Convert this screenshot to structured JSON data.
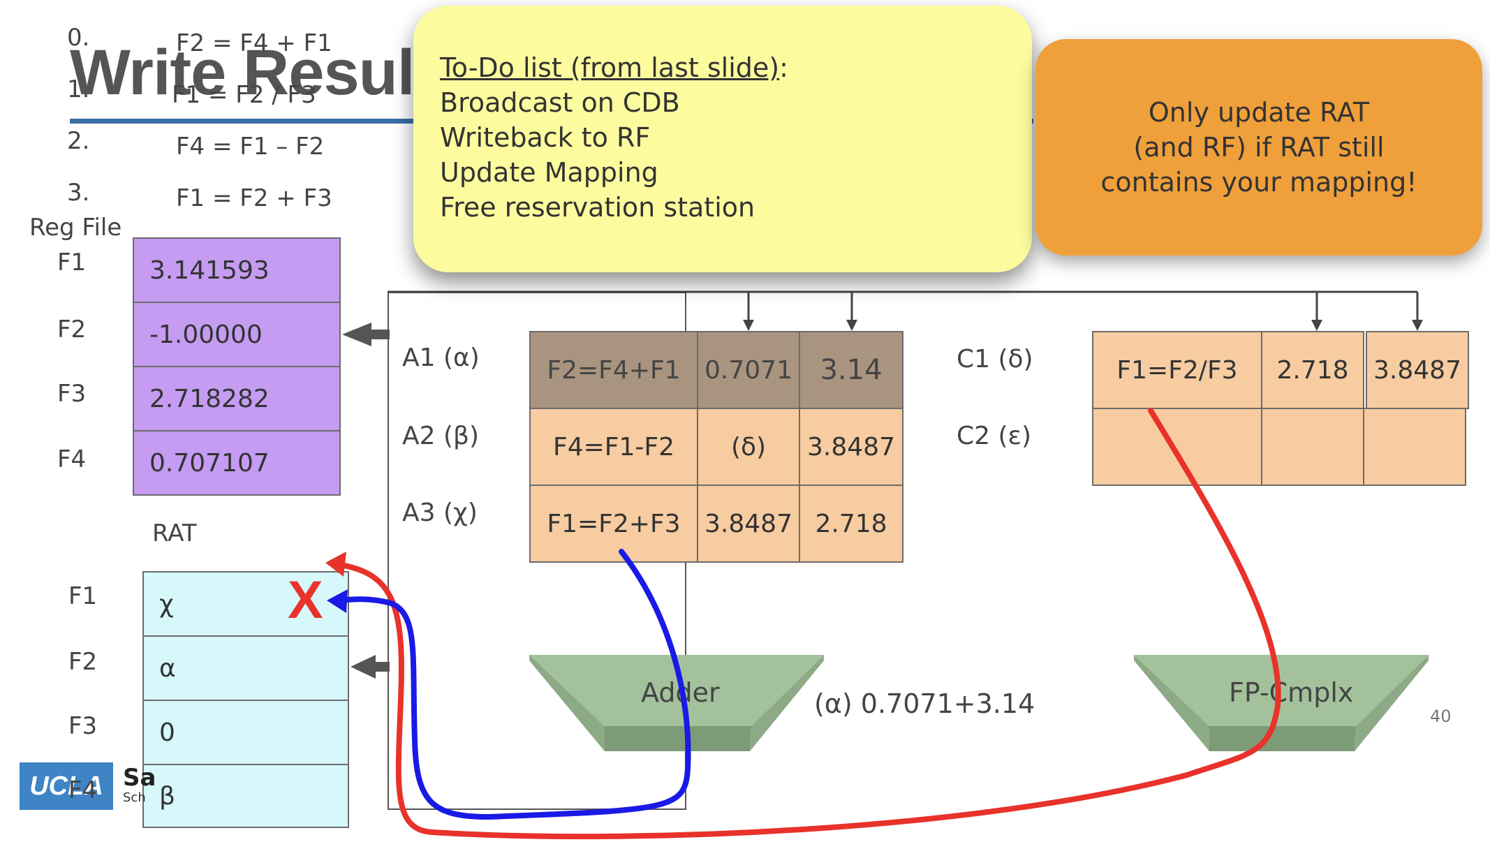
{
  "slide": {
    "title": "Write Result",
    "page_number": "40"
  },
  "instructions": [
    {
      "num": "0.",
      "text": "F2 = F4 + F1"
    },
    {
      "num": "1.",
      "text": "F1 = F2 / F3"
    },
    {
      "num": "2.",
      "text": "F4 = F1 – F2"
    },
    {
      "num": "3.",
      "text": "F1 = F2 + F3"
    }
  ],
  "reg_file": {
    "label": "Reg File",
    "rows": [
      {
        "reg": "F1",
        "value": "3.141593"
      },
      {
        "reg": "F2",
        "value": "-1.00000"
      },
      {
        "reg": "F3",
        "value": "2.718282"
      },
      {
        "reg": "F4",
        "value": "0.707107"
      }
    ]
  },
  "rat": {
    "label": "RAT",
    "rows": [
      {
        "reg": "F1",
        "value": "χ"
      },
      {
        "reg": "F2",
        "value": "α"
      },
      {
        "reg": "F3",
        "value": "0"
      },
      {
        "reg": "F4",
        "value": "β"
      }
    ],
    "invalid_mark": "X"
  },
  "adder_rs": {
    "rows": [
      {
        "name": "A1 (α)",
        "op": "F2=F4+F1",
        "v1": "0.7071",
        "v2": "3.14",
        "busy": true
      },
      {
        "name": "A2 (β)",
        "op": "F4=F1-F2",
        "v1": "(δ)",
        "v2": "3.8487",
        "busy": false
      },
      {
        "name": "A3 (χ)",
        "op": "F1=F2+F3",
        "v1": "3.8487",
        "v2": "2.718",
        "busy": false
      }
    ]
  },
  "cmplx_rs": {
    "rows": [
      {
        "name": "C1 (δ)",
        "op": "F1=F2/F3",
        "v1": "2.718",
        "v2": "3.8487"
      },
      {
        "name": "C2 (ε)",
        "op": "",
        "v1": "",
        "v2": ""
      }
    ]
  },
  "units": {
    "adder": "Adder",
    "adder_result": "(α) 0.7071+3.14",
    "cmplx": "FP-Cmplx"
  },
  "todo": {
    "heading": "To-Do list (from last slide)",
    "colon": ":",
    "items": [
      "Broadcast on CDB",
      "Writeback to RF",
      "Update Mapping",
      "Free reservation station"
    ]
  },
  "note": {
    "lines": [
      "Only update RAT",
      "(and RF) if RAT still",
      "contains your mapping!"
    ]
  },
  "logo": {
    "ucla": "UCLA",
    "samueli": "Sa",
    "school": "Sch"
  },
  "colors": {
    "reg_file": "#c59cf2",
    "rat": "#d7f8fb",
    "rs_busy": "#a99480",
    "rs_free": "#f7cca1",
    "unit": "#a3c29c",
    "todo_box": "#fcfc9e",
    "note_box": "#f0a03a",
    "red_path": "#e8322a",
    "blue_path": "#1a1ae6"
  }
}
